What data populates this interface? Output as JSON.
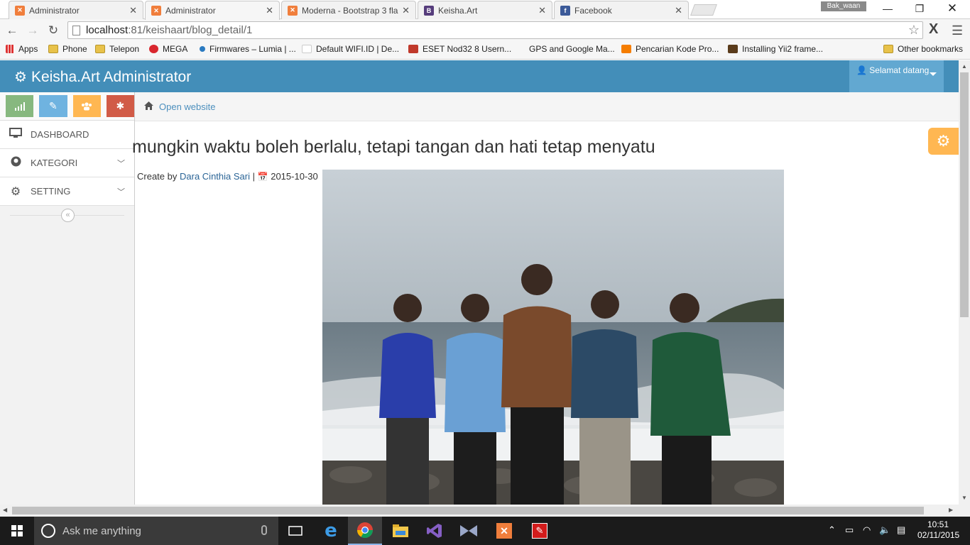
{
  "browser": {
    "tabs": [
      {
        "title": "Administrator",
        "favicon": "xampp-icon",
        "active": false
      },
      {
        "title": "Administrator",
        "favicon": "xampp-icon",
        "active": true
      },
      {
        "title": "Moderna - Bootstrap 3 fla",
        "favicon": "xampp-icon",
        "active": false
      },
      {
        "title": "Keisha.Art",
        "favicon": "bootstrap-icon",
        "active": false
      },
      {
        "title": "Facebook",
        "favicon": "facebook-icon",
        "active": false
      }
    ],
    "profile_name": "Bak_waan",
    "url_host": "localhost",
    "url_path": ":81/keishaart/blog_detail/1",
    "bookmarks": [
      {
        "label": "Apps",
        "icon": "apps-grid-icon"
      },
      {
        "label": "Phone",
        "icon": "folder-icon"
      },
      {
        "label": "Telepon",
        "icon": "folder-icon"
      },
      {
        "label": "MEGA",
        "icon": "mega-icon"
      },
      {
        "label": "Firmwares – Lumia | ...",
        "icon": "site-icon"
      },
      {
        "label": "Default WIFI.ID | De...",
        "icon": "page-icon"
      },
      {
        "label": "ESET Nod32 8 Usern...",
        "icon": "site-icon"
      },
      {
        "label": "GPS and Google Ma...",
        "icon": "page-icon"
      },
      {
        "label": "Pencarian Kode Pro...",
        "icon": "blogger-icon"
      },
      {
        "label": "Installing Yii2 frame...",
        "icon": "site-icon"
      },
      {
        "label": "Other bookmarks",
        "icon": "folder-icon"
      }
    ]
  },
  "app": {
    "brand": "Keisha.Art Administrator",
    "user_greeting": "Selamat datang",
    "colors": {
      "navbar": "#438eb9",
      "user_menu": "#62a8d1",
      "shortcut_green": "#87b87f",
      "shortcut_blue": "#6fb3e0",
      "shortcut_yellow": "#ffb752",
      "shortcut_red": "#d15b47"
    },
    "sidebar": {
      "items": [
        {
          "label": "DASHBOARD",
          "icon": "desktop-icon",
          "has_submenu": false
        },
        {
          "label": "KATEGORI",
          "icon": "github-icon",
          "has_submenu": true
        },
        {
          "label": "SETTING",
          "icon": "cogs-icon",
          "has_submenu": true
        }
      ]
    },
    "breadcrumb": {
      "link": "Open website"
    },
    "post": {
      "title": "mungkin waktu boleh berlalu, tetapi tangan dan hati tetap menyatu",
      "create_by_label": "Create by",
      "author": "Dara Cinthia Sari",
      "separator": "|",
      "date": "2015-10-30"
    }
  },
  "taskbar": {
    "search_placeholder": "Ask me anything",
    "time": "10:51",
    "date": "02/11/2015"
  }
}
